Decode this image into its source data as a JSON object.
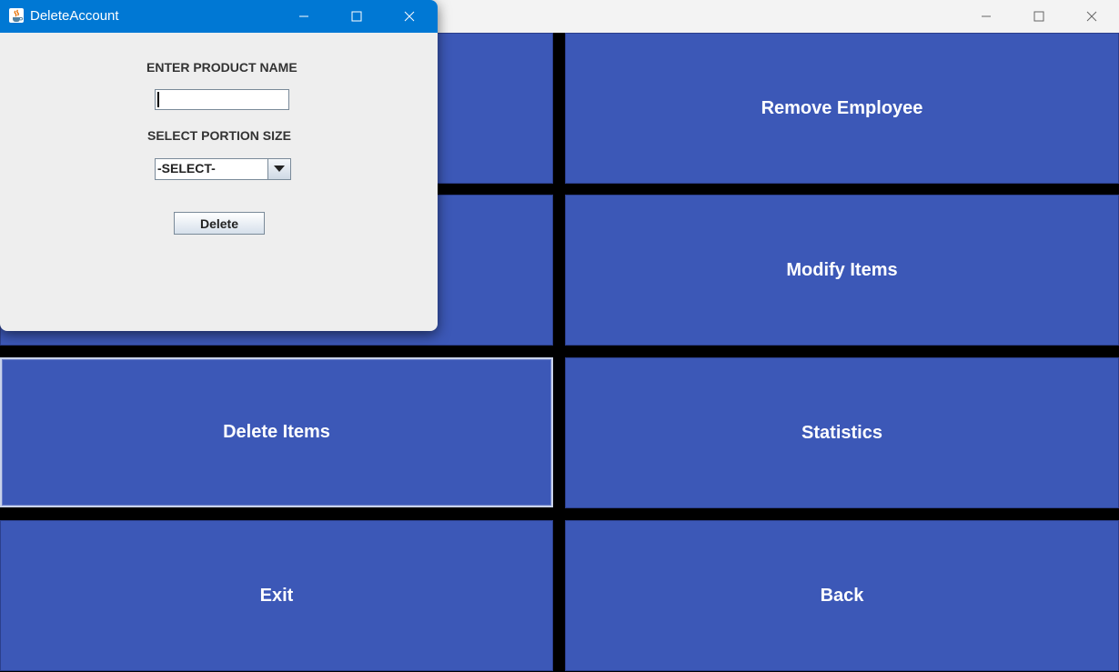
{
  "main_window": {
    "tiles": [
      {
        "label": ""
      },
      {
        "label": "Remove Employee"
      },
      {
        "label": ""
      },
      {
        "label": "Modify Items"
      },
      {
        "label": "Delete Items"
      },
      {
        "label": "Statistics"
      },
      {
        "label": "Exit"
      },
      {
        "label": "Back"
      }
    ],
    "tile_color": "#3c58b7",
    "icons": {
      "minimize": "minimize-icon",
      "maximize": "maximize-icon",
      "close": "close-icon"
    }
  },
  "dialog": {
    "title": "DeleteAccount",
    "app_icon": "java-icon",
    "titlebar_color": "#0078d4",
    "product_label": "ENTER PRODUCT NAME",
    "product_value": "",
    "portion_label": "SELECT PORTION SIZE",
    "portion_selected": "-SELECT-",
    "delete_label": "Delete"
  }
}
